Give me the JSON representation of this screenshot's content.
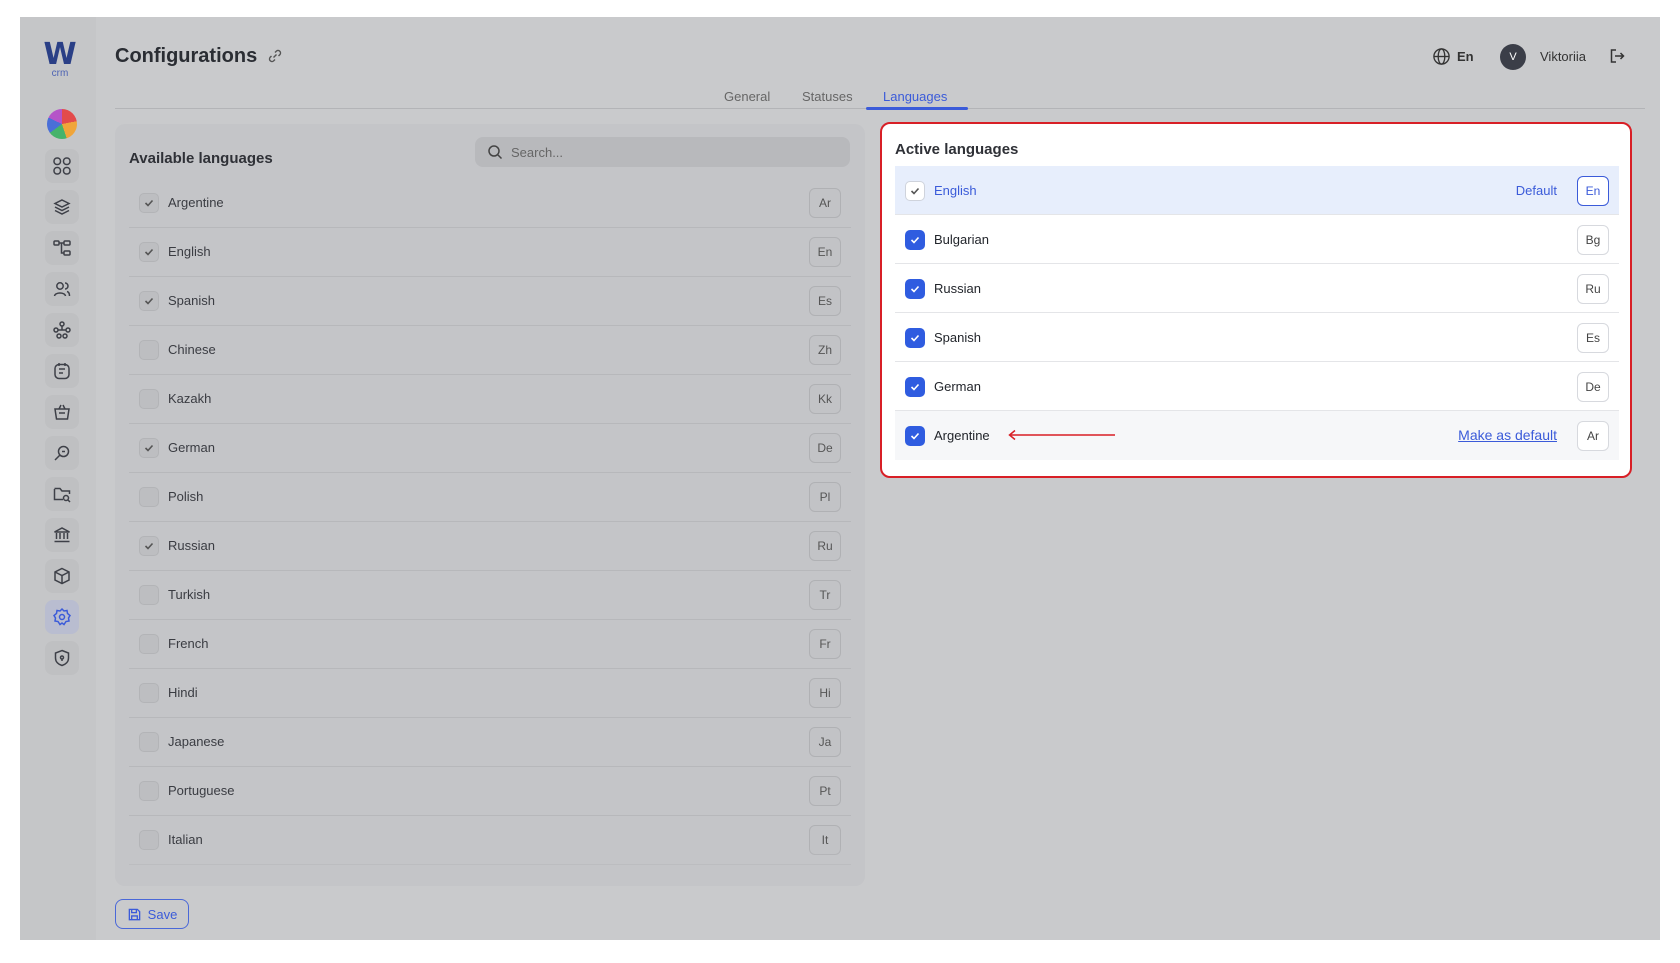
{
  "app": {
    "logo_mark": "W",
    "logo_sub": "crm",
    "title": "Configurations"
  },
  "header": {
    "language": "En",
    "avatar_initial": "V",
    "username": "Viktoriia"
  },
  "sidebar": {
    "items": [
      {
        "icon": "dashboard-grid-icon"
      },
      {
        "icon": "layers-icon"
      },
      {
        "icon": "hierarchy-icon"
      },
      {
        "icon": "users-icon"
      },
      {
        "icon": "network-icon"
      },
      {
        "icon": "notes-icon"
      },
      {
        "icon": "basket-icon"
      },
      {
        "icon": "search-key-icon"
      },
      {
        "icon": "folder-search-icon"
      },
      {
        "icon": "bank-icon"
      },
      {
        "icon": "package-icon"
      },
      {
        "icon": "gear-icon",
        "active": true
      },
      {
        "icon": "shield-icon"
      }
    ]
  },
  "tabs": [
    {
      "label": "General"
    },
    {
      "label": "Statuses"
    },
    {
      "label": "Languages",
      "active": true
    }
  ],
  "available": {
    "title": "Available languages",
    "search_placeholder": "Search...",
    "items": [
      {
        "name": "Argentine",
        "code": "Ar",
        "checked": true
      },
      {
        "name": "English",
        "code": "En",
        "checked": true
      },
      {
        "name": "Spanish",
        "code": "Es",
        "checked": true
      },
      {
        "name": "Chinese",
        "code": "Zh",
        "checked": false
      },
      {
        "name": "Kazakh",
        "code": "Kk",
        "checked": false
      },
      {
        "name": "German",
        "code": "De",
        "checked": true
      },
      {
        "name": "Polish",
        "code": "Pl",
        "checked": false
      },
      {
        "name": "Russian",
        "code": "Ru",
        "checked": true
      },
      {
        "name": "Turkish",
        "code": "Tr",
        "checked": false
      },
      {
        "name": "French",
        "code": "Fr",
        "checked": false
      },
      {
        "name": "Hindi",
        "code": "Hi",
        "checked": false
      },
      {
        "name": "Japanese",
        "code": "Ja",
        "checked": false
      },
      {
        "name": "Portuguese",
        "code": "Pt",
        "checked": false
      },
      {
        "name": "Italian",
        "code": "It",
        "checked": false
      }
    ]
  },
  "active": {
    "title": "Active languages",
    "default_label": "Default",
    "make_default_label": "Make as default",
    "items": [
      {
        "name": "English",
        "code": "En"
      },
      {
        "name": "Bulgarian",
        "code": "Bg"
      },
      {
        "name": "Russian",
        "code": "Ru"
      },
      {
        "name": "Spanish",
        "code": "Es"
      },
      {
        "name": "German",
        "code": "De"
      },
      {
        "name": "Argentine",
        "code": "Ar"
      }
    ]
  },
  "save_label": "Save",
  "colors": {
    "accent": "#3b5bd9",
    "highlight_border": "#d81f26",
    "default_row_bg": "#e7eefc"
  }
}
